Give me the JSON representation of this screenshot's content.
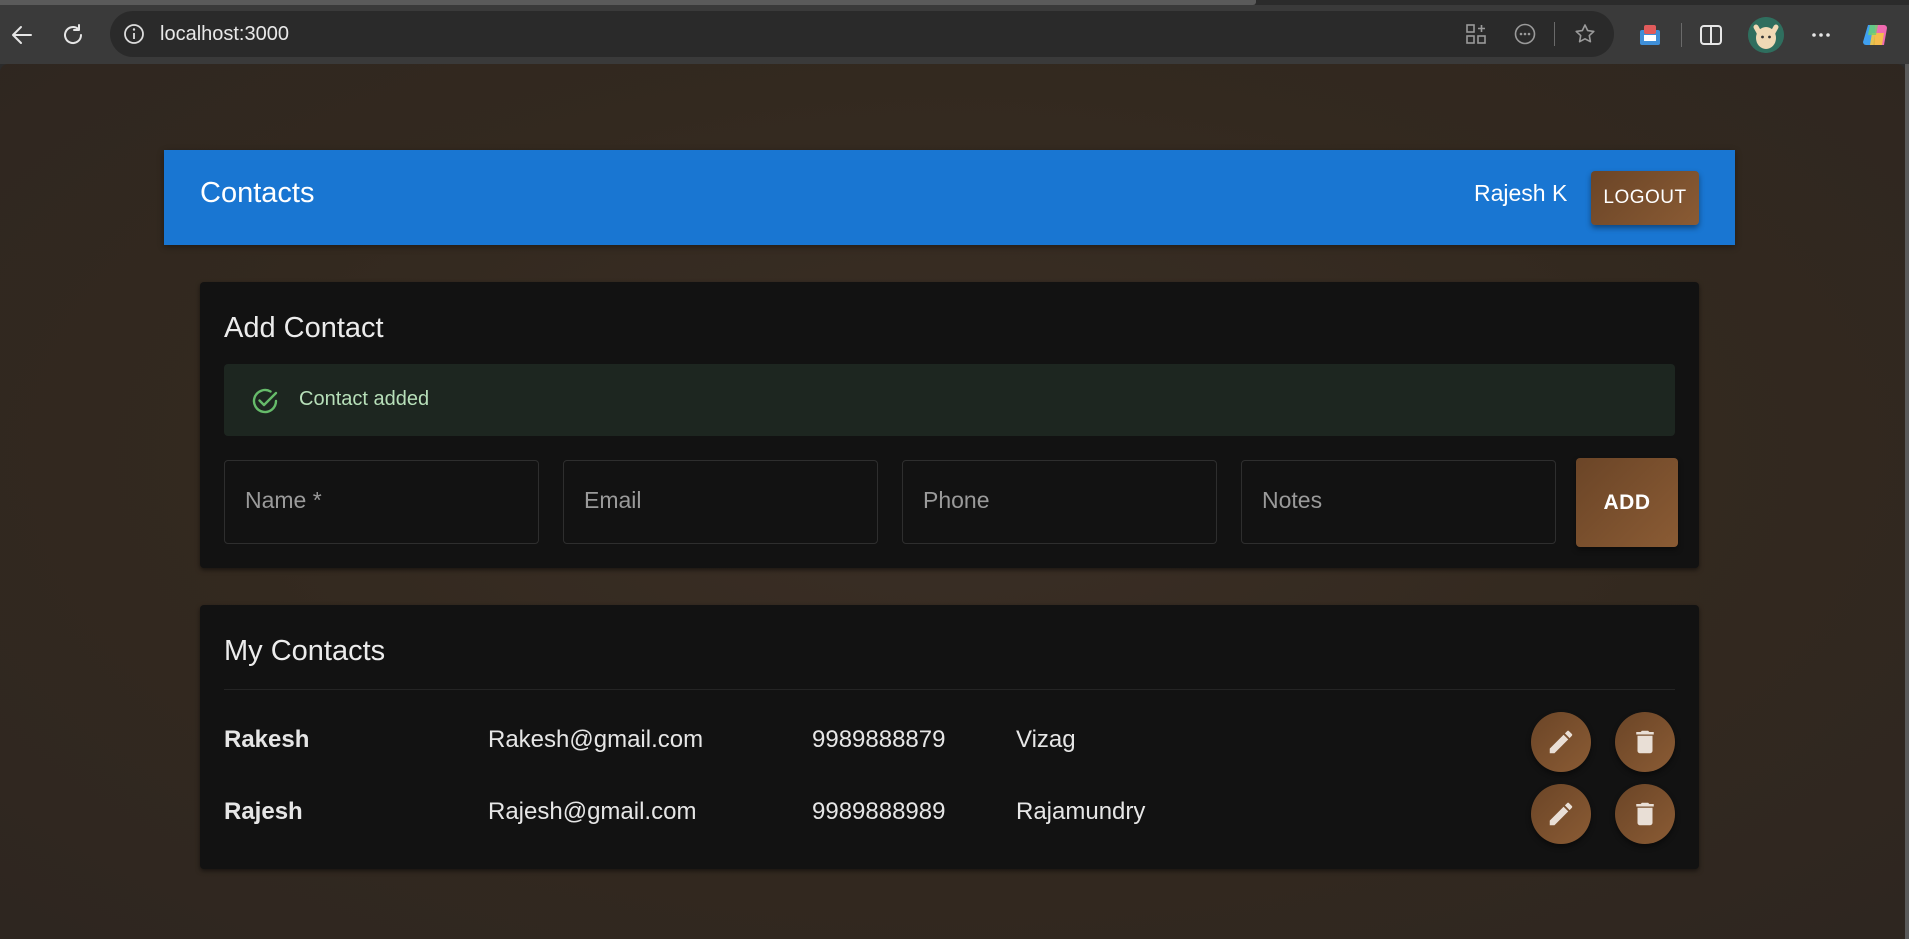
{
  "browser": {
    "url": "localhost:3000",
    "icons": {
      "back": "back-arrow-icon",
      "refresh": "refresh-icon",
      "info": "info-icon",
      "apps": "apps-icon",
      "more_page": "page-actions-icon",
      "favorite": "star-icon",
      "extension": "extension-icon",
      "split": "split-screen-icon",
      "profile": "profile-avatar",
      "menu": "more-icon",
      "copilot": "copilot-icon"
    }
  },
  "app": {
    "title": "Contacts",
    "user": "Rajesh K",
    "logout_label": "LOGOUT",
    "colors": {
      "appbar": "#1976d2",
      "accent": "#8a5b34",
      "success_text": "#b7dfb9"
    }
  },
  "add_contact": {
    "title": "Add Contact",
    "alert": "Contact added",
    "fields": {
      "name_placeholder": "Name *",
      "email_placeholder": "Email",
      "phone_placeholder": "Phone",
      "notes_placeholder": "Notes"
    },
    "add_label": "ADD"
  },
  "my_contacts": {
    "title": "My Contacts",
    "rows": [
      {
        "name": "Rakesh",
        "email": "Rakesh@gmail.com",
        "phone": "9989888879",
        "notes": "Vizag"
      },
      {
        "name": "Rajesh",
        "email": "Rajesh@gmail.com",
        "phone": "9989888989",
        "notes": "Rajamundry"
      }
    ]
  }
}
